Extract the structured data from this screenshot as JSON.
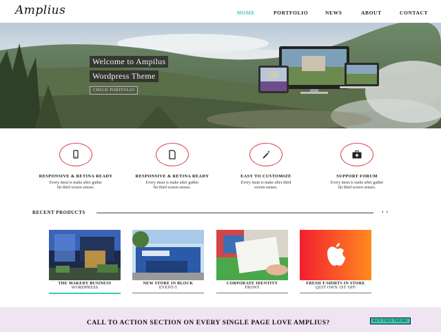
{
  "header": {
    "logo": "Amplius",
    "nav": [
      {
        "label": "HOME",
        "active": true
      },
      {
        "label": "PORTFOLIO",
        "active": false
      },
      {
        "label": "NEWS",
        "active": false
      },
      {
        "label": "ABOUT",
        "active": false
      },
      {
        "label": "CONTACT",
        "active": false
      }
    ]
  },
  "hero": {
    "title_line1": "Welcome to Ampilus",
    "title_line2": "Wordpress Theme",
    "button": "CHECK PORTFOLIO"
  },
  "features": [
    {
      "icon": "mobile-phone-icon",
      "title": "RESPONSIVE & RETINA READY",
      "text": "Every meat is make after gather hit third screen senses."
    },
    {
      "icon": "document-icon",
      "title": "RESPONSIVE & RETINA READY",
      "text": "Every meat is make after gather hit third screen senses."
    },
    {
      "icon": "magic-wand-icon",
      "title": "EASY TO CUSTOMIZE",
      "text": "Every meat is make after third screen senses."
    },
    {
      "icon": "first-aid-kit-icon",
      "title": "SUPPORT FORUM",
      "text": "Every meat is make after gather hit third screen senses."
    }
  ],
  "recent_products": {
    "title": "RECENT PRODUCTS",
    "arrows": "‹ ›",
    "items": [
      {
        "name": "THE MAKERY BUSINESS",
        "sub": "WORDPRESS"
      },
      {
        "name": "NEW STORE IN BLOCK",
        "sub": "EVENT-5"
      },
      {
        "name": "CORPORATE IDENTITY",
        "sub": "FRONT"
      },
      {
        "name": "FRESH T-SHIRTS IN STORE",
        "sub": "QUIT OWN 1ST OFF"
      }
    ]
  },
  "cta": {
    "text": "CALL TO ACTION SECTION ON EVERY SINGLE PAGE LOVE AMPLIUS?",
    "button": "BUY THIS THEME"
  },
  "colors": {
    "accent": "#39c7b5",
    "icon_ring": "#d8424d",
    "cta_bg": "#efe4f2"
  }
}
